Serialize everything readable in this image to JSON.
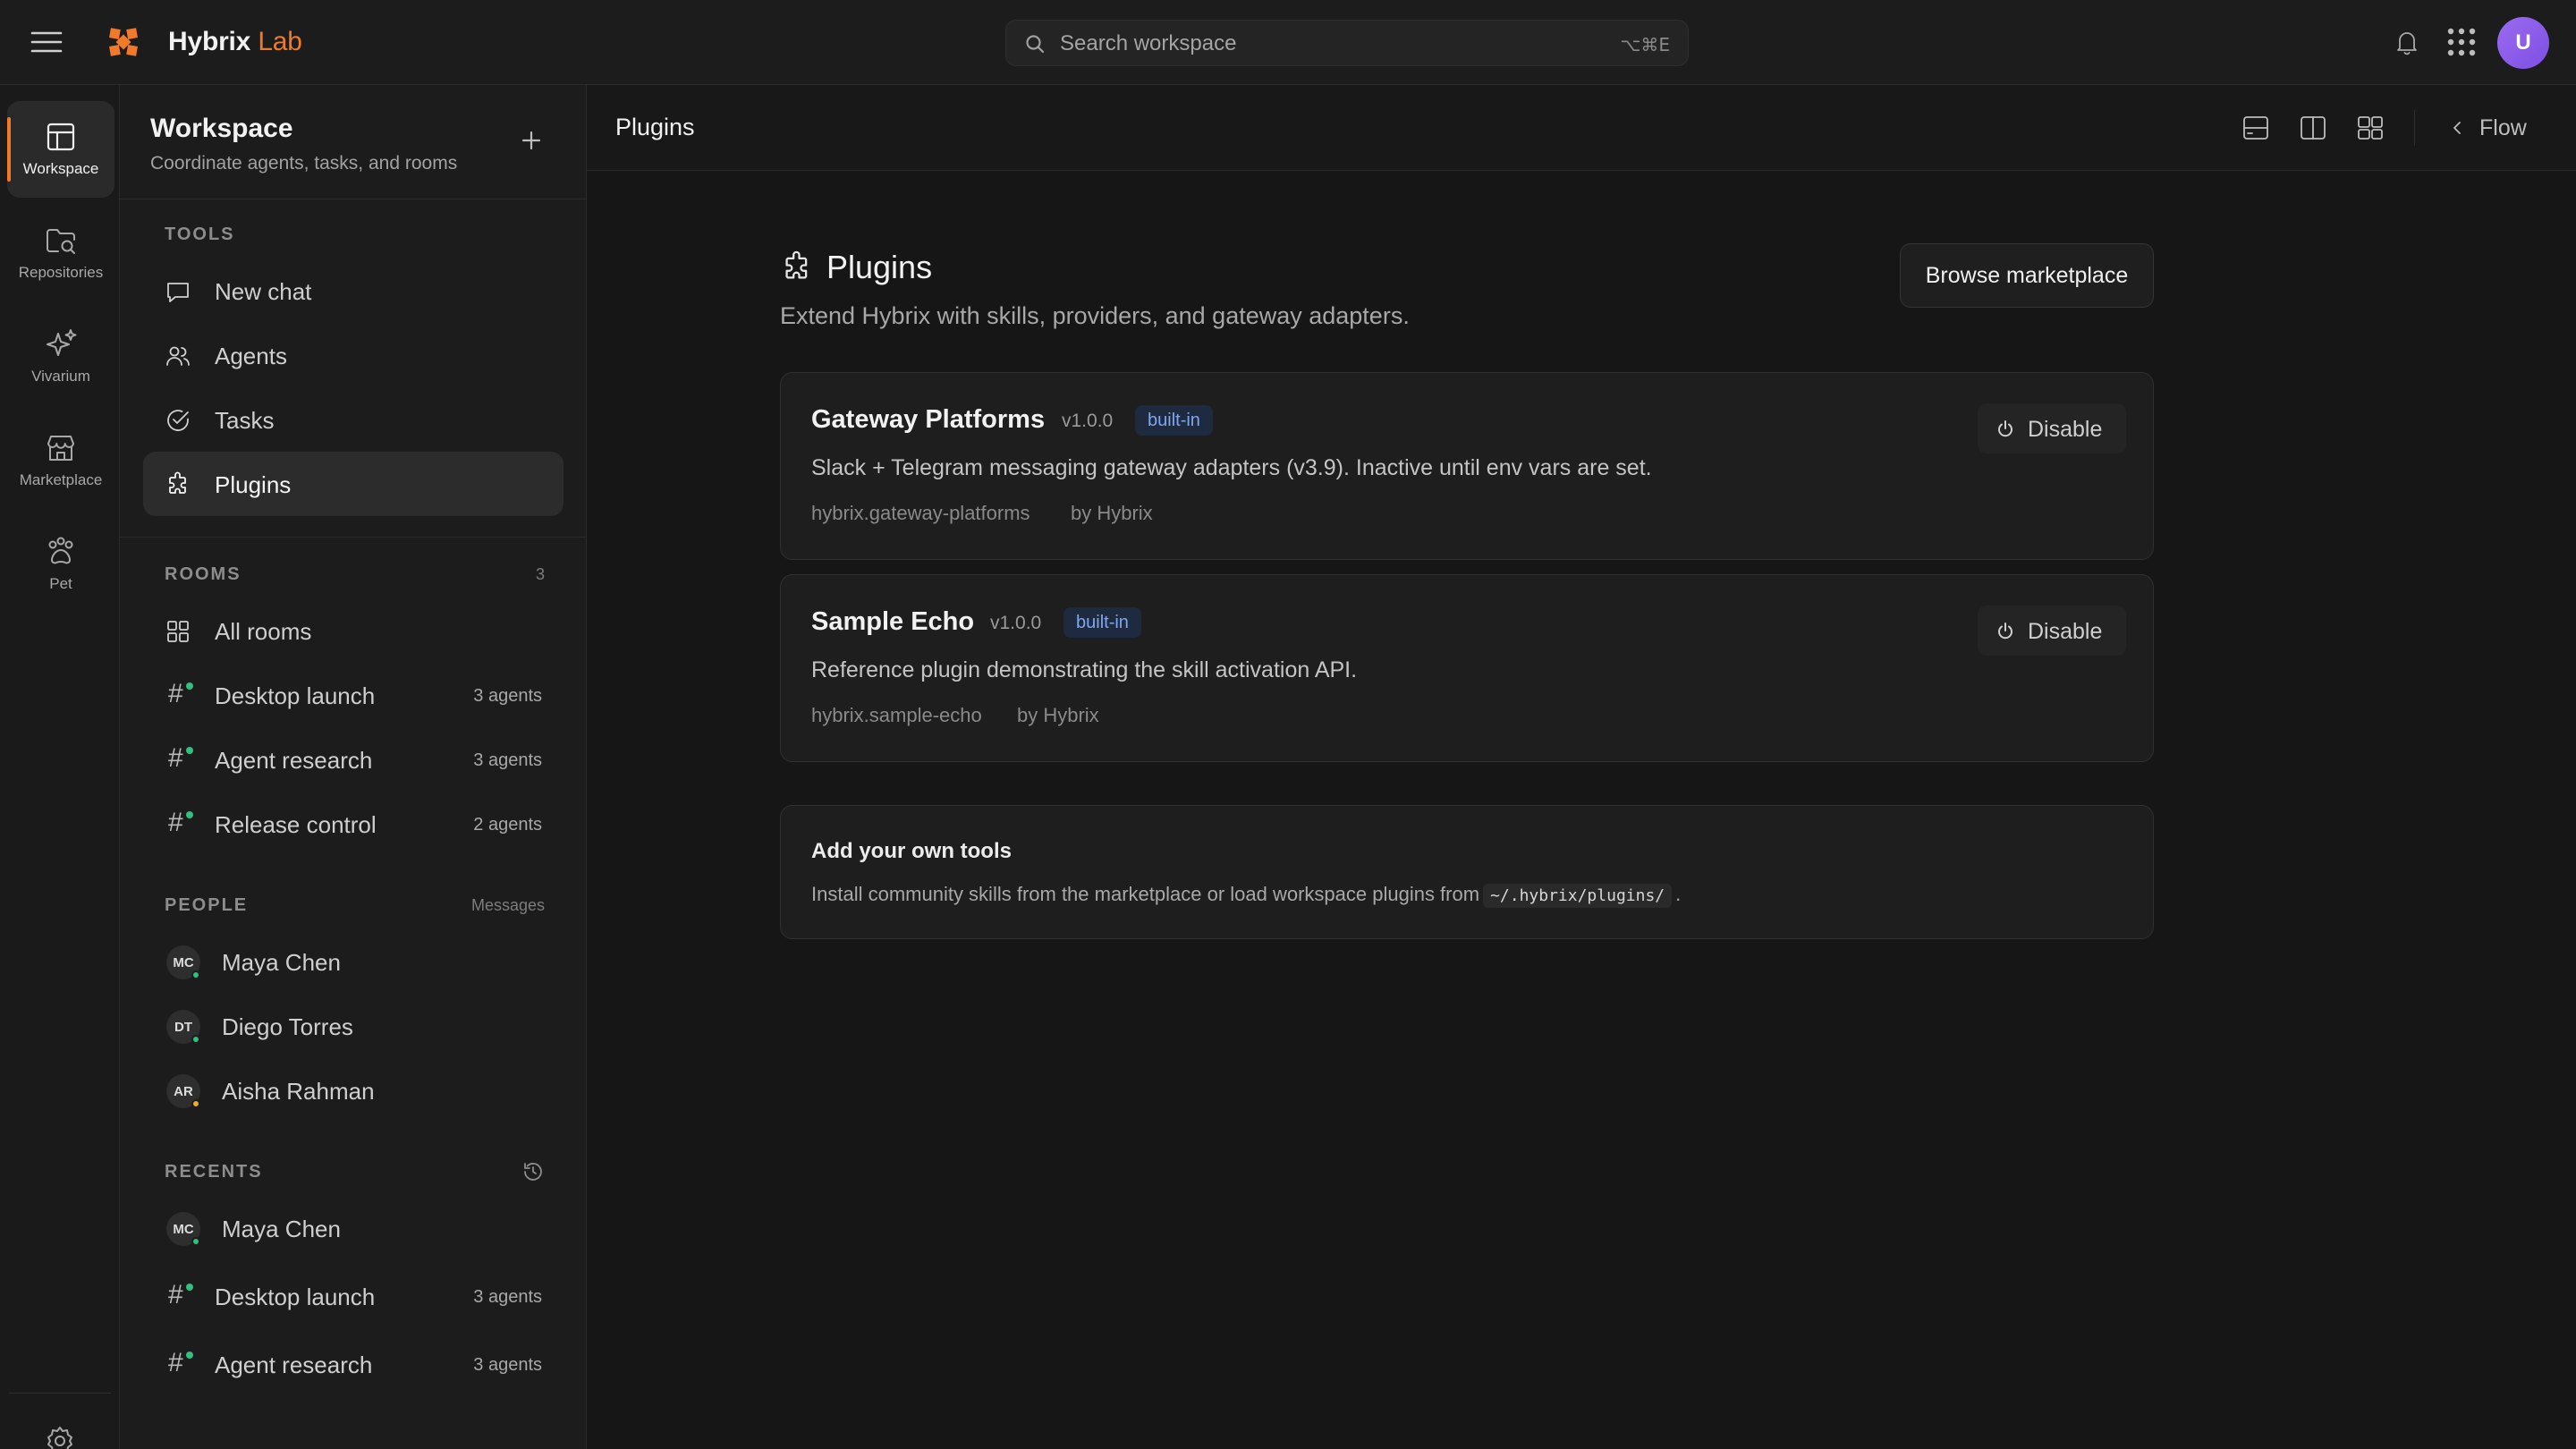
{
  "app": {
    "brand_name": "Hybrix",
    "brand_accent": "Lab",
    "accent_color": "#f07a2a",
    "user_initial": "U"
  },
  "search": {
    "placeholder": "Search workspace",
    "shortcut": "⌥⌘E"
  },
  "rail": {
    "items": [
      {
        "label": "Workspace",
        "icon": "layout-icon",
        "active": true
      },
      {
        "label": "Repositories",
        "icon": "folder-search-icon"
      },
      {
        "label": "Vivarium",
        "icon": "sparkles-icon"
      },
      {
        "label": "Marketplace",
        "icon": "store-icon"
      },
      {
        "label": "Pet",
        "icon": "paw-icon"
      }
    ],
    "settings_icon": "gear-icon"
  },
  "sidebar": {
    "title": "Workspace",
    "subtitle": "Coordinate agents, tasks, and rooms",
    "tools": {
      "label": "TOOLS",
      "items": [
        {
          "label": "New chat",
          "icon": "chat-icon"
        },
        {
          "label": "Agents",
          "icon": "users-icon"
        },
        {
          "label": "Tasks",
          "icon": "check-circle-icon"
        },
        {
          "label": "Plugins",
          "icon": "puzzle-icon",
          "active": true
        }
      ]
    },
    "rooms": {
      "label": "ROOMS",
      "count": "3",
      "all_label": "All rooms",
      "items": [
        {
          "label": "Desktop launch",
          "meta": "3 agents"
        },
        {
          "label": "Agent research",
          "meta": "3 agents"
        },
        {
          "label": "Release control",
          "meta": "2 agents"
        }
      ]
    },
    "people": {
      "label": "PEOPLE",
      "aside": "Messages",
      "items": [
        {
          "initials": "MC",
          "name": "Maya Chen",
          "status": "online"
        },
        {
          "initials": "DT",
          "name": "Diego Torres",
          "status": "online"
        },
        {
          "initials": "AR",
          "name": "Aisha Rahman",
          "status": "away"
        }
      ]
    },
    "recents": {
      "label": "RECENTS",
      "person": {
        "initials": "MC",
        "name": "Maya Chen"
      },
      "rooms": [
        {
          "label": "Desktop launch",
          "meta": "3 agents"
        },
        {
          "label": "Agent research",
          "meta": "3 agents"
        }
      ]
    }
  },
  "main": {
    "header_title": "Plugins",
    "flow_label": "Flow",
    "page_title": "Plugins",
    "page_subtitle": "Extend Hybrix with skills, providers, and gateway adapters.",
    "browse_label": "Browse marketplace",
    "plugins": [
      {
        "name": "Gateway Platforms",
        "version": "v1.0.0",
        "badge": "built-in",
        "description": "Slack + Telegram messaging gateway adapters (v3.9). Inactive until env vars are set.",
        "id": "hybrix.gateway-platforms",
        "author": "by Hybrix",
        "action": "Disable"
      },
      {
        "name": "Sample Echo",
        "version": "v1.0.0",
        "badge": "built-in",
        "description": "Reference plugin demonstrating the skill activation API.",
        "id": "hybrix.sample-echo",
        "author": "by Hybrix",
        "action": "Disable"
      }
    ],
    "tools_card": {
      "title": "Add your own tools",
      "text_before": "Install community skills from the marketplace or load workspace plugins from",
      "path": "~/.hybrix/plugins/",
      "text_after": "."
    }
  }
}
